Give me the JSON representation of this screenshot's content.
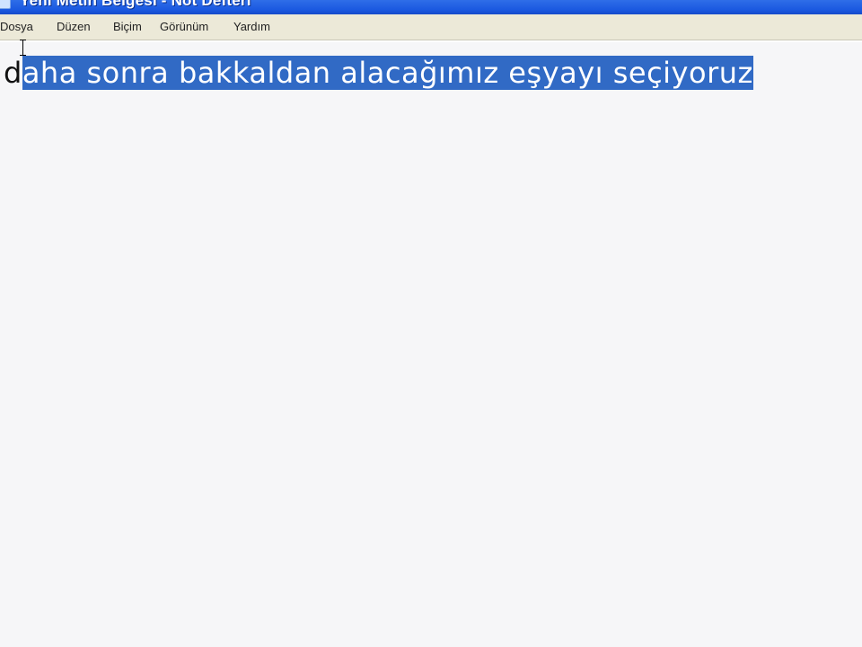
{
  "window": {
    "title": "Yeni Metin Belgesi - Not Defteri"
  },
  "menubar": {
    "items": [
      {
        "label": "Dosya"
      },
      {
        "label": "Düzen"
      },
      {
        "label": "Biçim"
      },
      {
        "label": "Görünüm"
      },
      {
        "label": "Yardım"
      }
    ]
  },
  "editor": {
    "text_unselected": "d",
    "text_selected": "aha sonra bakkaldan alacağımız eşyayı seçiyoruz"
  },
  "colors": {
    "titlebar": "#1a58e0",
    "menubar": "#ece9d8",
    "selection": "#316ac5",
    "editor_bg": "#f6f6f8"
  }
}
